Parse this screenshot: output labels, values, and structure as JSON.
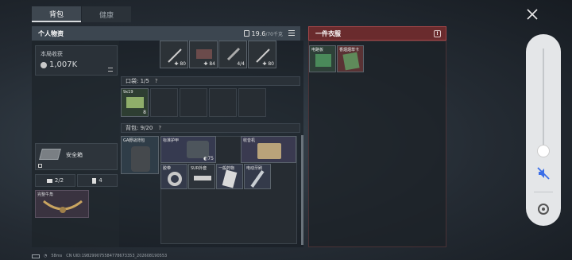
{
  "tabs": [
    {
      "label": "背包"
    },
    {
      "label": "健康"
    }
  ],
  "left_panel": {
    "title": "个人物资",
    "weight_current": "19.6",
    "weight_max": "/70千克",
    "earnings_label": "本局收获",
    "earnings_value": "1,007K",
    "safe_box_label": "安全箱",
    "counter_a": "2/2",
    "counter_b": "4",
    "charm_label": "完整牛角"
  },
  "top_items": [
    {
      "count": "80"
    },
    {
      "count": "84"
    },
    {
      "count": "4/4"
    },
    {
      "count": "80"
    }
  ],
  "pocket": {
    "label": "口袋: 1/5",
    "q": "?",
    "item_label": "9x19",
    "item_count": "8"
  },
  "backpack": {
    "label": "背包: 9/20",
    "q": "?",
    "vest_label": "GA野战背包",
    "armor_label": "标准护甲",
    "armor_count": "75",
    "radio_label": "收音机",
    "item_a": "胶带",
    "item_b": "SUR外套",
    "item_c": "一般药物",
    "item_d": "电动牙刷"
  },
  "right_panel": {
    "title": "一件衣服",
    "item_1": "电路板",
    "item_2": "香烟烟草卡"
  },
  "status": {
    "signal": "58ms",
    "uid": "CN UID:1982990755847786733​53_2026081​90553"
  },
  "colors": {
    "accent_red": "#6a2b2d",
    "panel_bg": "#2b3239"
  }
}
